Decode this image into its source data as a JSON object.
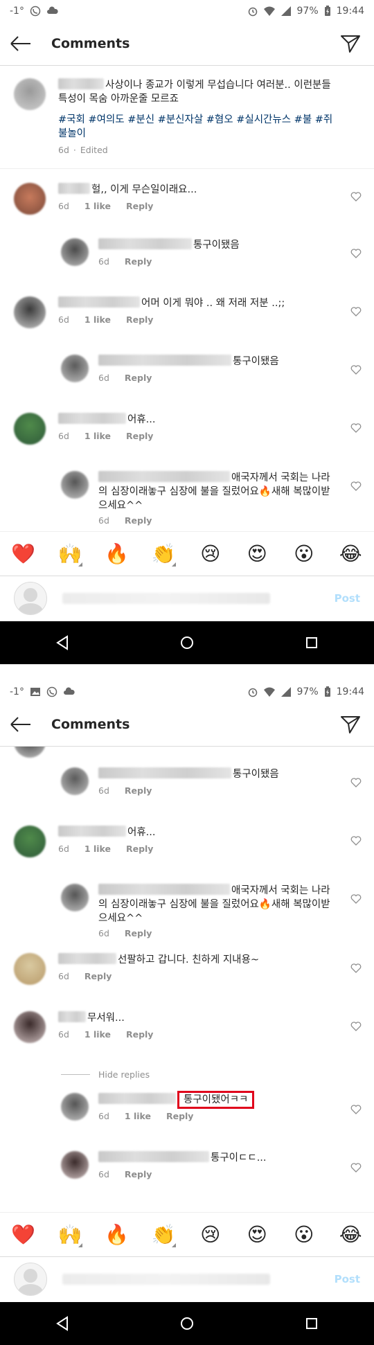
{
  "status": {
    "signal": "-1°",
    "battery": "97%",
    "time": "19:44"
  },
  "header": {
    "title": "Comments"
  },
  "caption": {
    "text": "사상이나 종교가 이렇게 무섭습니다 여러분.. 이런분들 특성이 목숨 아까운줄 모르죠",
    "tags": "#국회 #여의도 #분신 #분신자살 #혐오 #실시간뉴스 #불 #쥐불놀이",
    "time": "6d",
    "edited": "Edited"
  },
  "comments": {
    "c1": {
      "text": "헐,, 이게 무슨일이래요...",
      "time": "6d",
      "likes": "1 like",
      "reply": "Reply"
    },
    "c1r1": {
      "text": "통구이됐음",
      "time": "6d",
      "reply": "Reply"
    },
    "c2": {
      "text": "어머 이게 뭐야 .. 왜 저래 저분 ..;;",
      "time": "6d",
      "likes": "1 like",
      "reply": "Reply"
    },
    "c2r1": {
      "text": "통구이됐음",
      "time": "6d",
      "reply": "Reply"
    },
    "c3": {
      "text": "어휴...",
      "time": "6d",
      "likes": "1 like",
      "reply": "Reply"
    },
    "c3r1": {
      "text": "애국자께서 국회는 나라의 심장이래놓구 심장에 불을 질렀어요🔥새해 복많이받으세요^^",
      "time": "6d",
      "reply": "Reply"
    },
    "c4": {
      "text": "선팔하고 갑니다.  친하게 지내용~",
      "time": "6d",
      "reply": "Reply"
    },
    "c5": {
      "text": "무서워...",
      "time": "6d",
      "likes": "1 like",
      "reply": "Reply"
    },
    "hide_replies": "Hide replies",
    "c5r1": {
      "text": "통구이됐어ㅋㅋ",
      "time": "6d",
      "likes": "1 like",
      "reply": "Reply"
    },
    "c5r2": {
      "text": "통구이ㄷㄷ...",
      "time": "6d",
      "reply": "Reply"
    }
  },
  "emojis": [
    "❤️",
    "🙌",
    "🔥",
    "👏",
    "😢",
    "😍",
    "😮",
    "😂"
  ],
  "composer": {
    "post": "Post"
  },
  "colors": {
    "tag": "#003569",
    "post_disabled": "#b2dffc",
    "highlight": "#e0001b"
  }
}
